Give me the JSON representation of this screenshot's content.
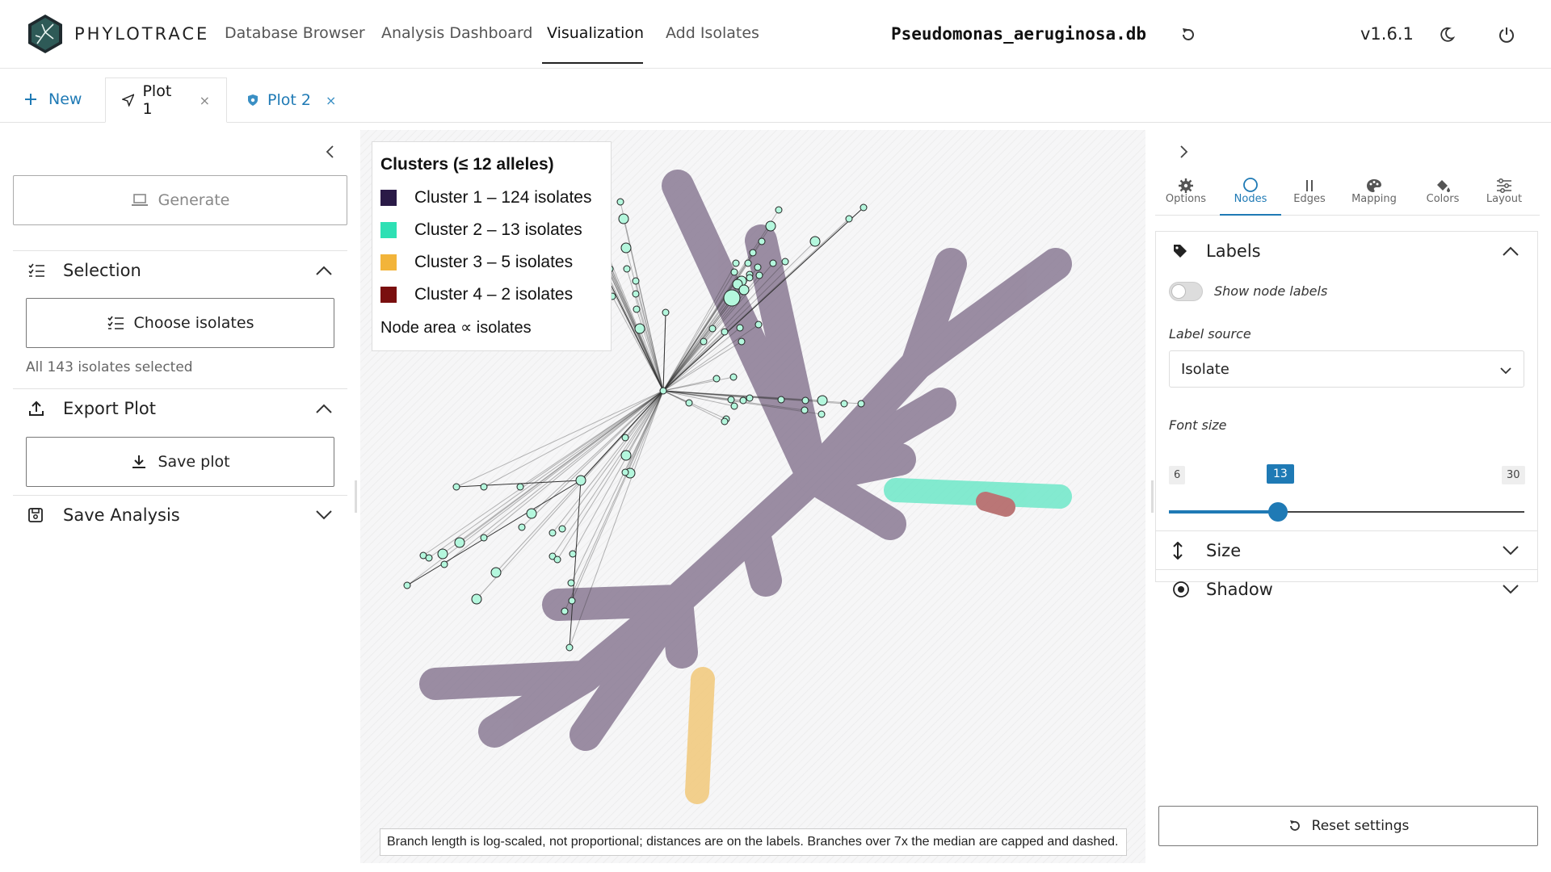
{
  "app": {
    "brand": "PHYLOTRACE",
    "nav": [
      "Database Browser",
      "Analysis Dashboard",
      "Visualization",
      "Add Isolates"
    ],
    "active_nav": "Visualization",
    "database": "Pseudomonas_aeruginosa.db",
    "version": "v1.6.1"
  },
  "tabs": {
    "new_label": "New",
    "items": [
      {
        "label": "Plot 1",
        "active": true
      },
      {
        "label": "Plot 2",
        "active": false
      }
    ],
    "close_glyph": "×"
  },
  "left": {
    "generate_label": "Generate",
    "selection_title": "Selection",
    "choose_isolates_label": "Choose isolates",
    "selected_note": "All 143 isolates selected",
    "export_title": "Export Plot",
    "save_plot_label": "Save plot",
    "save_analysis_title": "Save Analysis"
  },
  "legend": {
    "title": "Clusters (≤ 12 alleles)",
    "items": [
      {
        "label": "Cluster 1 – 124 isolates",
        "color": "#2a1a47"
      },
      {
        "label": "Cluster 2 – 13 isolates",
        "color": "#2ee0b4"
      },
      {
        "label": "Cluster 3 – 5 isolates",
        "color": "#f2b43a"
      },
      {
        "label": "Cluster 4 – 2 isolates",
        "color": "#7a0f0f"
      }
    ],
    "node_area_label": "Node area ∝ isolates"
  },
  "caption": "Branch length is log-scaled, not proportional; distances are on the labels. Branches over 7x the median are capped and dashed.",
  "colors": {
    "accent": "#1f7ab5",
    "node_fill": "#b4f7dd",
    "cluster1_hull": "#8a7a94",
    "cluster2_hull": "#6ee8c9",
    "cluster3_hull": "#f2c97a",
    "cluster4_hull": "#b06060"
  },
  "right": {
    "tabs": [
      "Options",
      "Nodes",
      "Edges",
      "Mapping",
      "Colors",
      "Layout"
    ],
    "active_tab": "Nodes",
    "labels_title": "Labels",
    "show_labels_text": "Show node labels",
    "show_labels_on": false,
    "label_source_title": "Label source",
    "label_source_value": "Isolate",
    "font_size_title": "Font size",
    "font_min": "6",
    "font_value": "13",
    "font_max": "30",
    "size_title": "Size",
    "shadow_title": "Shadow",
    "reset_label": "Reset settings"
  }
}
